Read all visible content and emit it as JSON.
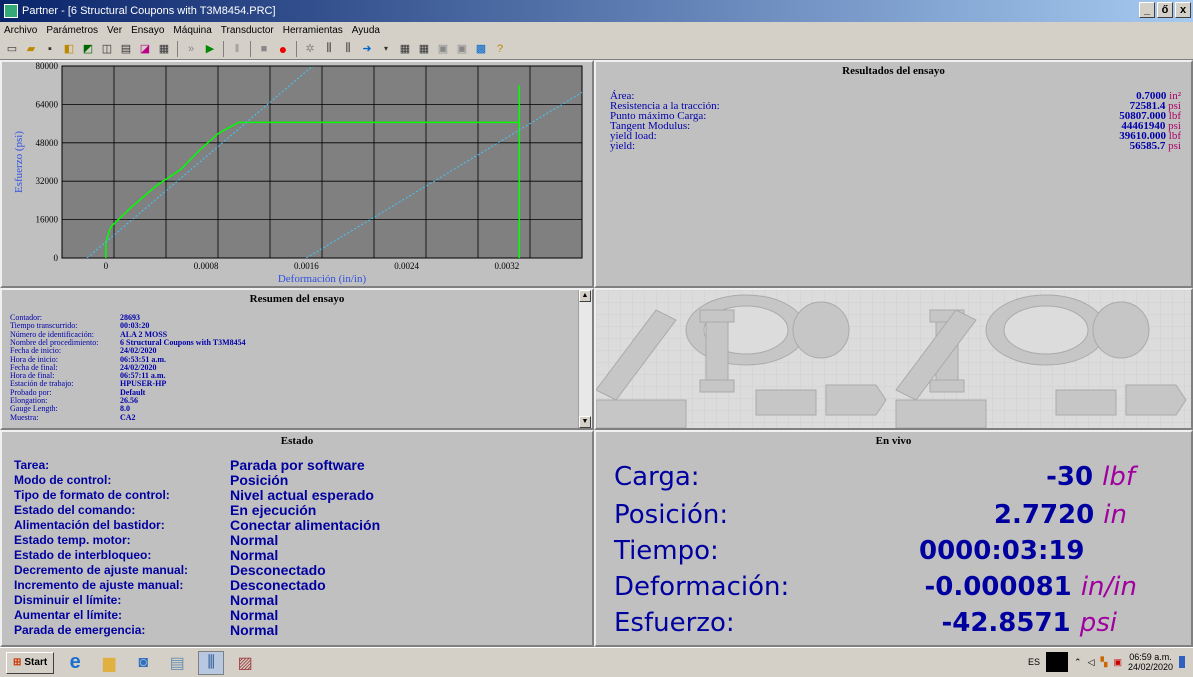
{
  "window": {
    "title": "Partner - [6 Structural Coupons with T3M8454.PRC]",
    "min": "_",
    "restore": "ő",
    "close": "x"
  },
  "menu": [
    "Archivo",
    "Parámetros",
    "Ver",
    "Ensayo",
    "Máquina",
    "Transductor",
    "Herramientas",
    "Ayuda"
  ],
  "chart_data": {
    "type": "line",
    "xlabel": "Deformación (in/in)",
    "ylabel": "Esfuerzo (psi)",
    "xlim": [
      -0.00035,
      0.0038
    ],
    "ylim": [
      0,
      80000
    ],
    "xticks": [
      0,
      0.0008,
      0.0016,
      0.0024,
      0.0032
    ],
    "xtick_labels": [
      "0",
      "0.0008",
      "0.0016",
      "0.0024",
      "0.0032"
    ],
    "yticks": [
      0,
      16000,
      32000,
      48000,
      64000,
      80000
    ],
    "ytick_labels": [
      "0",
      "16000",
      "32000",
      "48000",
      "64000",
      "80000"
    ],
    "grid": true,
    "series": [
      {
        "color": "#00ff00",
        "style": "solid",
        "x": [
          0,
          0,
          2e-05,
          4e-05,
          0.0002,
          0.0004,
          0.0006,
          0.00075,
          0.0009,
          0.00106,
          0.0033,
          0.0033,
          0.0033
        ],
        "y": [
          0,
          6500,
          10000,
          13000,
          21000,
          30000,
          37000,
          45000,
          52000,
          56500,
          56500,
          0,
          72000
        ]
      },
      {
        "color": "#40c8ff",
        "style": "dashed",
        "x": [
          -0.00015,
          0.00165
        ],
        "y": [
          0,
          80000
        ]
      },
      {
        "color": "#40c8ff",
        "style": "dashed",
        "x": [
          0.0016,
          0.0038
        ],
        "y": [
          0,
          69000
        ]
      }
    ]
  },
  "results": {
    "title": "Resultados del ensayo",
    "rows": [
      {
        "label": "Área:",
        "value": "0.7000",
        "unit": "in²"
      },
      {
        "label": "Resistencia a la tracción:",
        "value": "72581.4",
        "unit": "psi"
      },
      {
        "label": "Punto máximo Carga:",
        "value": "50807.000",
        "unit": "lbf"
      },
      {
        "label": "Tangent Modulus:",
        "value": "44461940",
        "unit": "psi"
      },
      {
        "label": "yield load:",
        "value": "39610.000",
        "unit": "lbf"
      },
      {
        "label": "yield:",
        "value": "56585.7",
        "unit": "psi"
      }
    ]
  },
  "summary": {
    "title": "Resumen del ensayo",
    "rows": [
      {
        "label": "Contador:",
        "value": "28693"
      },
      {
        "label": "Tiempo transcurrido:",
        "value": "00:03:20"
      },
      {
        "label": "Número de identificación:",
        "value": "ALA 2 MOSS"
      },
      {
        "label": "Nombre del procedimiento:",
        "value": "6 Structural Coupons with T3M8454"
      },
      {
        "label": "Fecha de inicio:",
        "value": "24/02/2020"
      },
      {
        "label": "Hora de inicio:",
        "value": "06:53:51 a.m."
      },
      {
        "label": "Fecha de final:",
        "value": "24/02/2020"
      },
      {
        "label": "Hora de final:",
        "value": "06:57:11 a.m."
      },
      {
        "label": "Estación de trabajo:",
        "value": "HPUSER-HP"
      },
      {
        "label": "Probado por:",
        "value": "Default"
      },
      {
        "label": "Elongation:",
        "value": "26.56"
      },
      {
        "label": "Gauge Length:",
        "value": "8.0"
      },
      {
        "label": "Muestra:",
        "value": "CA2"
      }
    ]
  },
  "estado": {
    "title": "Estado",
    "rows": [
      {
        "label": "Tarea:",
        "value": "Parada por software"
      },
      {
        "label": "Modo de control:",
        "value": "Posición"
      },
      {
        "label": "Tipo de formato de control:",
        "value": "Nivel actual esperado"
      },
      {
        "label": "Estado del comando:",
        "value": "En ejecución"
      },
      {
        "label": "Alimentación del bastidor:",
        "value": "Conectar alimentación"
      },
      {
        "label": "Estado temp. motor:",
        "value": "Normal"
      },
      {
        "label": "Estado de interbloqueo:",
        "value": "Normal"
      },
      {
        "label": "Decremento de ajuste manual:",
        "value": "Desconectado"
      },
      {
        "label": "Incremento de ajuste manual:",
        "value": "Desconectado"
      },
      {
        "label": "Disminuir el límite:",
        "value": "Normal"
      },
      {
        "label": "Aumentar el límite:",
        "value": "Normal"
      },
      {
        "label": "Parada de emergencia:",
        "value": "Normal"
      }
    ]
  },
  "live": {
    "title": "En vivo",
    "rows": [
      {
        "label": "Carga:",
        "value": "-30",
        "unit": "lbf"
      },
      {
        "label": "Posición:",
        "value": "2.7720",
        "unit": "in"
      },
      {
        "label": "Tiempo:",
        "value": "0000:03:19",
        "unit": ""
      },
      {
        "label": "Deformación:",
        "value": "-0.000081",
        "unit": "in/in"
      },
      {
        "label": "Esfuerzo:",
        "value": "-42.8571",
        "unit": "psi"
      }
    ]
  },
  "taskbar": {
    "start": "Start",
    "lang": "ES",
    "time": "06:59 a.m.",
    "date": "24/02/2020"
  }
}
